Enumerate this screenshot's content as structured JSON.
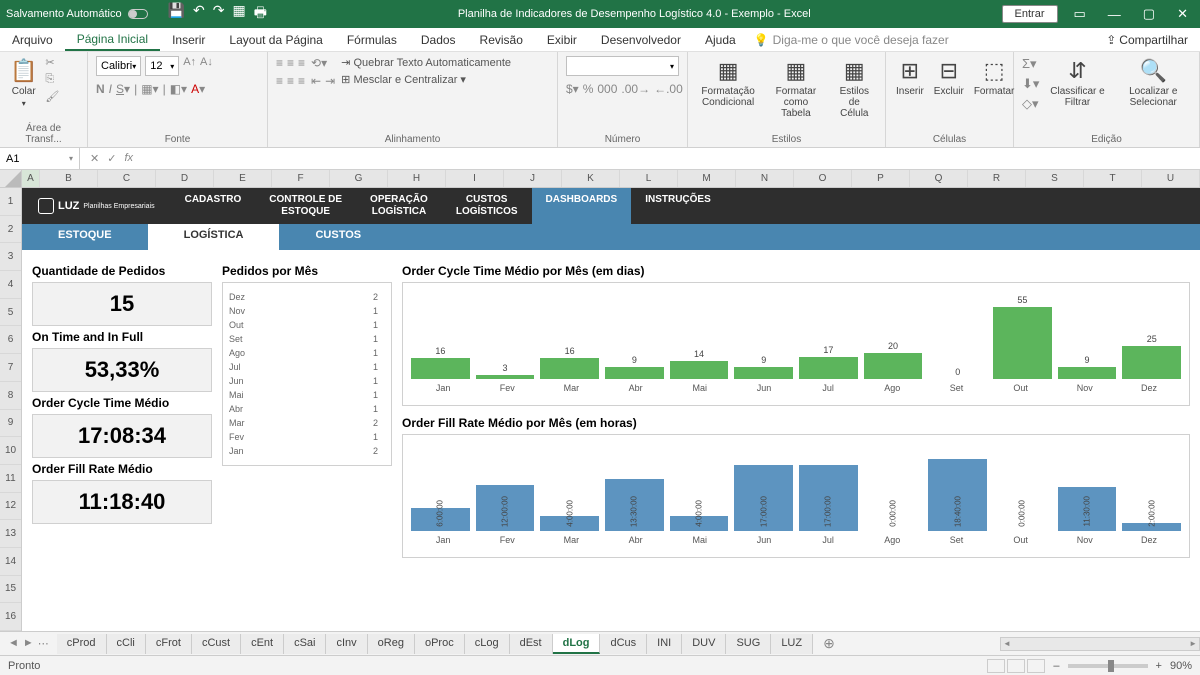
{
  "titlebar": {
    "autosave": "Salvamento Automático",
    "title": "Planilha de Indicadores de Desempenho Logístico 4.0 - Exemplo  -  Excel",
    "signin": "Entrar"
  },
  "menu": {
    "items": [
      "Arquivo",
      "Página Inicial",
      "Inserir",
      "Layout da Página",
      "Fórmulas",
      "Dados",
      "Revisão",
      "Exibir",
      "Desenvolvedor",
      "Ajuda"
    ],
    "tellme": "Diga-me o que você deseja fazer",
    "share": "Compartilhar"
  },
  "ribbon": {
    "clipboard": {
      "paste": "Colar",
      "label": "Área de Transf..."
    },
    "font": {
      "name": "Calibri",
      "size": "12",
      "label": "Fonte"
    },
    "align": {
      "wrap": "Quebrar Texto Automaticamente",
      "merge": "Mesclar e Centralizar",
      "label": "Alinhamento"
    },
    "number": {
      "label": "Número"
    },
    "styles": {
      "cond": "Formatação Condicional",
      "table": "Formatar como Tabela",
      "cell": "Estilos de Célula",
      "label": "Estilos"
    },
    "cells": {
      "insert": "Inserir",
      "delete": "Excluir",
      "format": "Formatar",
      "label": "Células"
    },
    "editing": {
      "sort": "Classificar e Filtrar",
      "find": "Localizar e Selecionar",
      "label": "Edição"
    }
  },
  "formula": {
    "cell": "A1"
  },
  "cols": [
    "A",
    "B",
    "C",
    "D",
    "E",
    "F",
    "G",
    "H",
    "I",
    "J",
    "K",
    "L",
    "M",
    "N",
    "O",
    "P",
    "Q",
    "R",
    "S",
    "T",
    "U"
  ],
  "rows": [
    "1",
    "2",
    "3",
    "4",
    "5",
    "6",
    "7",
    "8",
    "9",
    "10",
    "11",
    "12",
    "13",
    "14",
    "15",
    "16"
  ],
  "dnav": {
    "logo": "LUZ",
    "logosub": "Planilhas Empresariais",
    "tabs": [
      {
        "label": "CADASTRO"
      },
      {
        "label": "CONTROLE DE\nESTOQUE"
      },
      {
        "label": "OPERAÇÃO\nLOGÍSTICA"
      },
      {
        "label": "CUSTOS\nLOGÍSTICOS"
      },
      {
        "label": "DASHBOARDS",
        "active": true
      },
      {
        "label": "INSTRUÇÕES"
      }
    ]
  },
  "subnav": [
    "ESTOQUE",
    "LOGÍSTICA",
    "CUSTOS"
  ],
  "kpis": [
    {
      "title": "Quantidade de Pedidos",
      "value": "15"
    },
    {
      "title": "On Time and In Full",
      "value": "53,33%"
    },
    {
      "title": "Order Cycle Time Médio",
      "value": "17:08:34"
    },
    {
      "title": "Order Fill Rate Médio",
      "value": "11:18:40"
    }
  ],
  "chart_data": [
    {
      "type": "bar",
      "orientation": "horizontal",
      "title": "Pedidos por Mês",
      "categories": [
        "Dez",
        "Nov",
        "Out",
        "Set",
        "Ago",
        "Jul",
        "Jun",
        "Mai",
        "Abr",
        "Mar",
        "Fev",
        "Jan"
      ],
      "values": [
        2,
        1,
        1,
        1,
        1,
        1,
        1,
        1,
        1,
        2,
        1,
        2
      ]
    },
    {
      "type": "bar",
      "title": "Order Cycle Time Médio por Mês (em dias)",
      "categories": [
        "Jan",
        "Fev",
        "Mar",
        "Abr",
        "Mai",
        "Jun",
        "Jul",
        "Ago",
        "Set",
        "Out",
        "Nov",
        "Dez"
      ],
      "values": [
        16,
        3,
        16,
        9,
        14,
        9,
        17,
        20,
        0,
        55,
        9,
        25
      ],
      "color": "#5cb55c"
    },
    {
      "type": "bar",
      "title": "Order Fill Rate Médio por Mês (em horas)",
      "categories": [
        "Jan",
        "Fev",
        "Mar",
        "Abr",
        "Mai",
        "Jun",
        "Jul",
        "Ago",
        "Set",
        "Out",
        "Nov",
        "Dez"
      ],
      "values": [
        6,
        12,
        4,
        13.5,
        4,
        17,
        17,
        0,
        18.67,
        0,
        11.5,
        2
      ],
      "value_labels": [
        "6:00:00",
        "12:00:00",
        "4:00:00",
        "13:30:00",
        "4:00:00",
        "17:00:00",
        "17:00:00",
        "0:00:00",
        "18:40:00",
        "0:00:00",
        "11:30:00",
        "2:00:00"
      ],
      "color": "#5d94c0"
    }
  ],
  "sheets": [
    "cProd",
    "cCli",
    "cFrot",
    "cCust",
    "cEnt",
    "cSai",
    "cInv",
    "oReg",
    "oProc",
    "cLog",
    "dEst",
    "dLog",
    "dCus",
    "INI",
    "DUV",
    "SUG",
    "LUZ"
  ],
  "active_sheet": "dLog",
  "status": {
    "ready": "Pronto",
    "zoom": "90%"
  }
}
